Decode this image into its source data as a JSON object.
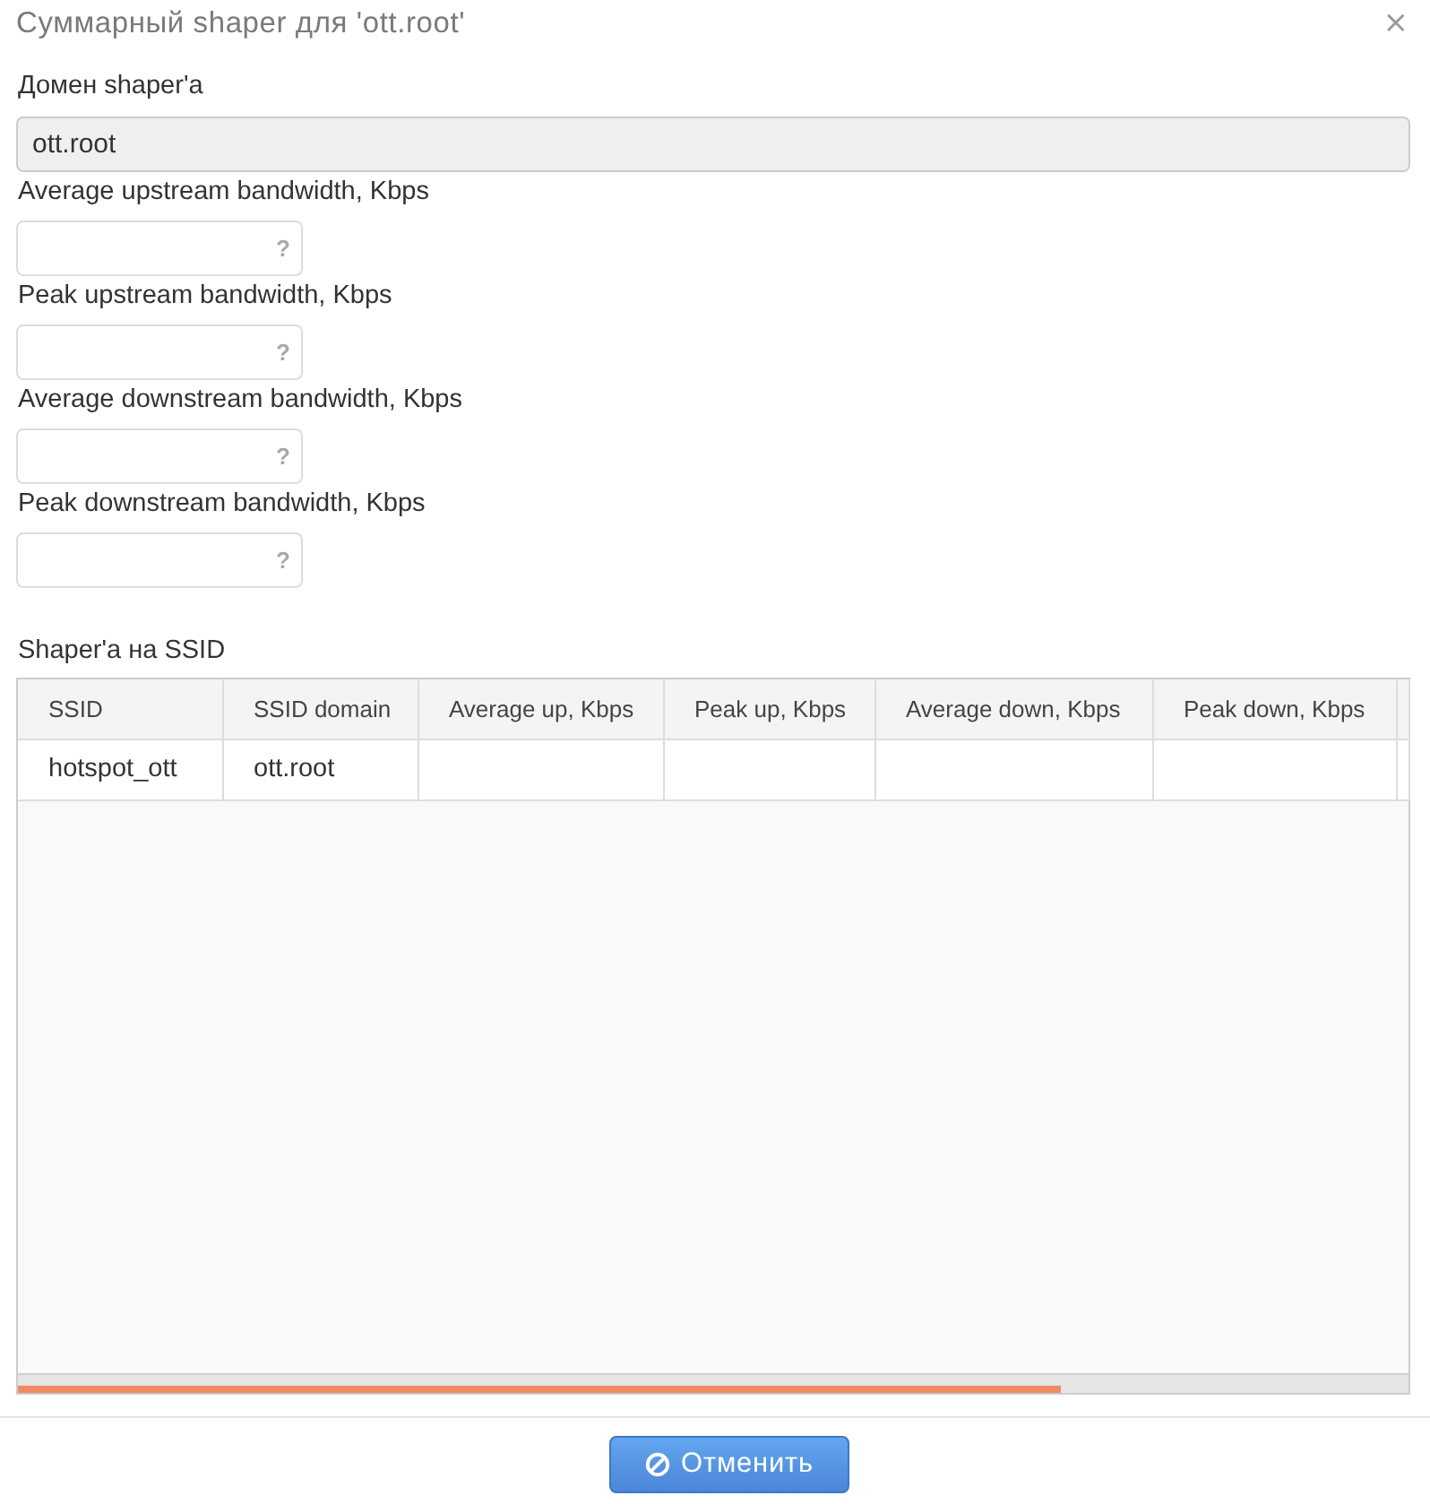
{
  "dialog": {
    "title": "Суммарный shaper для 'ott.root'",
    "close": "×"
  },
  "domain": {
    "label": "Домен shaper'a",
    "value": "ott.root",
    "readonly": true
  },
  "bandwidth_fields": [
    {
      "label": "Average upstream bandwidth, Kbps",
      "help": "?"
    },
    {
      "label": "Peak upstream bandwidth, Kbps",
      "help": "?"
    },
    {
      "label": "Average downstream bandwidth, Kbps",
      "help": "?"
    },
    {
      "label": "Peak downstream bandwidth, Kbps",
      "help": "?"
    }
  ],
  "ssid_shapers": {
    "title": "Shaper'a на SSID",
    "columns": [
      "SSID",
      "SSID domain",
      "Average up, Kbps",
      "Peak up, Kbps",
      "Average down, Kbps",
      "Peak down, Kbps"
    ],
    "rows": [
      {
        "cells": [
          "hotspot_ott",
          "ott.root"
        ]
      }
    ]
  },
  "buttons": [
    {
      "label": "Отменить",
      "kind": "cancel"
    }
  ]
}
